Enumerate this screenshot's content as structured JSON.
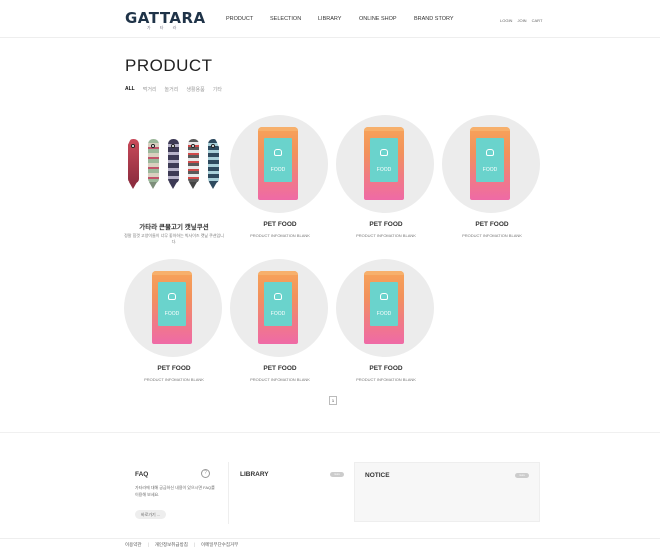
{
  "header": {
    "logo": "GATTARA",
    "logo_sub": "가 타 라",
    "nav": [
      "PRODUCT",
      "SELECTION",
      "LIBRARY",
      "ONLINE SHOP",
      "BRAND STORY"
    ],
    "util": [
      "LOGIN",
      "JOIN",
      "CART"
    ]
  },
  "page": {
    "title": "PRODUCT",
    "categories": [
      "ALL",
      "먹거리",
      "놀거리",
      "생활용품",
      "기타"
    ]
  },
  "products": [
    {
      "name": "가타라 큰물고기 캣닢쿠션",
      "desc": "정말 힘껏 고양이들이 너무 좋아하는 빅사이즈 캣닢 쿠션입니다.",
      "image": "fish-cushions"
    },
    {
      "name": "PET FOOD",
      "desc": "PRODUCT INFOMATION BLANK",
      "image": "pet-food-bag",
      "bag_text": "FOOD"
    },
    {
      "name": "PET FOOD",
      "desc": "PRODUCT INFOMATION BLANK",
      "image": "pet-food-bag",
      "bag_text": "FOOD"
    },
    {
      "name": "PET FOOD",
      "desc": "PRODUCT INFOMATION BLANK",
      "image": "pet-food-bag",
      "bag_text": "FOOD"
    },
    {
      "name": "PET FOOD",
      "desc": "PRODUCT INFOMATION BLANK",
      "image": "pet-food-bag",
      "bag_text": "FOOD"
    },
    {
      "name": "PET FOOD",
      "desc": "PRODUCT INFOMATION BLANK",
      "image": "pet-food-bag",
      "bag_text": "FOOD"
    },
    {
      "name": "PET FOOD",
      "desc": "PRODUCT INFOMATION BLANK",
      "image": "pet-food-bag",
      "bag_text": "FOOD"
    }
  ],
  "pagination": {
    "current": "1"
  },
  "faq": {
    "title": "FAQ",
    "help": "?",
    "text": "가타라에 대해 궁금하신 내용이 있으시면 FAQ를 이용해 보세요.",
    "button": "바로가기 ..."
  },
  "library": {
    "title": "LIBRARY",
    "more": "more"
  },
  "notice": {
    "title": "NOTICE",
    "more": "more"
  },
  "footer": {
    "links": [
      "이용약관",
      "개인정보취급방침",
      "이메일무단수집거부"
    ],
    "separator": "|"
  },
  "colors": {
    "logo": "#1f3348",
    "bag_top": "#f7a35a",
    "bag_bottom": "#ef6aa6",
    "bag_label": "#6ad3cc",
    "thumb_bg": "#ececec"
  }
}
